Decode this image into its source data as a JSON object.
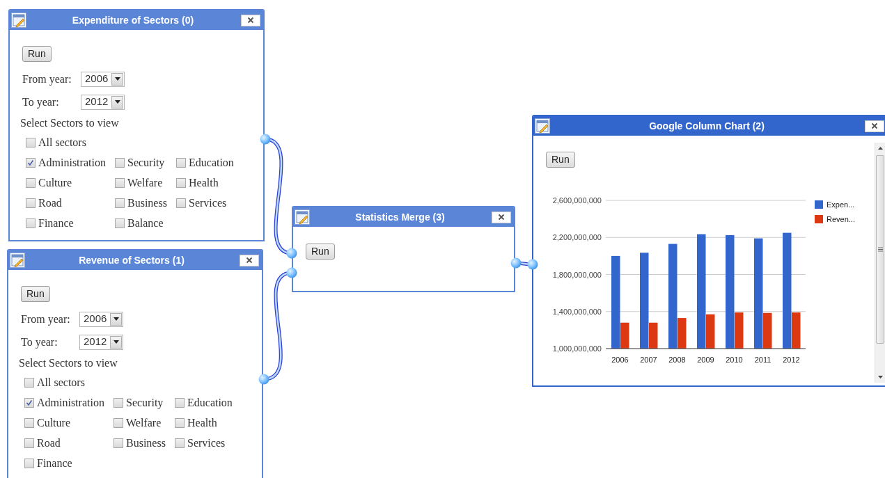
{
  "windows": [
    {
      "kind": "form",
      "title": "Expenditure of Sectors (0)",
      "focused": false,
      "run": "Run",
      "fields": [
        {
          "label": "From year:",
          "value": "2006"
        },
        {
          "label": "To year:",
          "value": "2012"
        }
      ],
      "sectors_heading": "Select Sectors to view",
      "all_sectors": {
        "label": "All sectors",
        "checked": false
      },
      "sectors": [
        {
          "label": "Administration",
          "checked": true
        },
        {
          "label": "Security",
          "checked": false
        },
        {
          "label": "Education",
          "checked": false
        },
        {
          "label": "Culture",
          "checked": false
        },
        {
          "label": "Welfare",
          "checked": false
        },
        {
          "label": "Health",
          "checked": false
        },
        {
          "label": "Road",
          "checked": false
        },
        {
          "label": "Business",
          "checked": false
        },
        {
          "label": "Services",
          "checked": false
        },
        {
          "label": "Finance",
          "checked": false
        },
        {
          "label": "Balance",
          "checked": false
        }
      ]
    },
    {
      "kind": "form",
      "title": "Revenue of Sectors (1)",
      "focused": false,
      "run": "Run",
      "fields": [
        {
          "label": "From year:",
          "value": "2006"
        },
        {
          "label": "To year:",
          "value": "2012"
        }
      ],
      "sectors_heading": "Select Sectors to view",
      "all_sectors": {
        "label": "All sectors",
        "checked": false
      },
      "sectors": [
        {
          "label": "Administration",
          "checked": true
        },
        {
          "label": "Security",
          "checked": false
        },
        {
          "label": "Education",
          "checked": false
        },
        {
          "label": "Culture",
          "checked": false
        },
        {
          "label": "Welfare",
          "checked": false
        },
        {
          "label": "Health",
          "checked": false
        },
        {
          "label": "Road",
          "checked": false
        },
        {
          "label": "Business",
          "checked": false
        },
        {
          "label": "Services",
          "checked": false
        },
        {
          "label": "Finance",
          "checked": false
        }
      ]
    },
    {
      "kind": "merge",
      "title": "Statistics Merge (3)",
      "focused": false,
      "run": "Run"
    },
    {
      "kind": "chart",
      "title": "Google Column Chart (2)",
      "focused": true,
      "run": "Run",
      "chart_data": {
        "type": "bar",
        "categories": [
          "2006",
          "2007",
          "2008",
          "2009",
          "2010",
          "2011",
          "2012"
        ],
        "series": [
          {
            "name": "Expen...",
            "color": "#3366cc",
            "values": [
              2000000000,
              2035000000,
              2130000000,
              2235000000,
              2225000000,
              2190000000,
              2250000000
            ]
          },
          {
            "name": "Reven...",
            "color": "#dc3912",
            "values": [
              1280000000,
              1280000000,
              1330000000,
              1370000000,
              1390000000,
              1385000000,
              1390000000
            ]
          }
        ],
        "ylim": [
          1000000000,
          2600000000
        ],
        "grid": true,
        "legend": true,
        "yticks": [
          {
            "value": 1000000000,
            "label": "1,000,000,000"
          },
          {
            "value": 1400000000,
            "label": "1,400,000,000"
          },
          {
            "value": 1800000000,
            "label": "1,800,000,000"
          },
          {
            "value": 2200000000,
            "label": "2,200,000,000"
          },
          {
            "value": 2600000000,
            "label": "2,600,000,000"
          }
        ]
      }
    }
  ]
}
